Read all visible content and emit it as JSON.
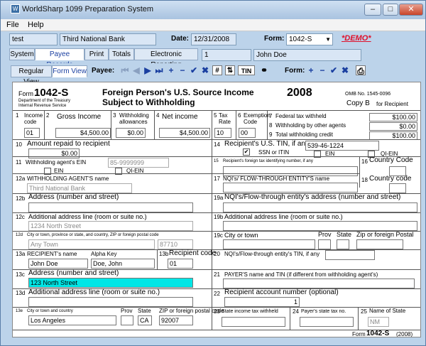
{
  "window": {
    "title": "WorldSharp 1099 Preparation System",
    "min": "–",
    "max": "□",
    "close": "✕"
  },
  "menu": {
    "file": "File",
    "help": "Help"
  },
  "header": {
    "company_id": "test",
    "company_name": "Third National Bank",
    "date_label": "Date:",
    "date": "12/31/2008",
    "form_label": "Form:",
    "form_value": "1042-S",
    "demo": "*DEMO*"
  },
  "tabs": [
    "System",
    "Payee Records",
    "Print",
    "Totals",
    "Electronic Reporting"
  ],
  "record": {
    "num": "1",
    "name": "John Doe"
  },
  "view_tabs": [
    "Regular View",
    "Form View"
  ],
  "toolbar": {
    "payee_label": "Payee:",
    "form_label": "Form:",
    "tin_label": "TIN",
    "hash": "#"
  },
  "form": {
    "form_word": "Form",
    "form_number": "1042-S",
    "dept": "Department of the Treasury",
    "irs": "Internal Revenue Service",
    "title1": "Foreign Person's U.S. Source Income",
    "title2": "Subject to Withholding",
    "year": "2008",
    "omb": "OMB No. 1545-0096",
    "copy": "Copy B",
    "copy_for": "for Recipient",
    "b1": "1",
    "b1l": "Income code",
    "b1v": "01",
    "b2": "2",
    "b2l": "Gross Income",
    "b2v": "$4,500.00",
    "b3": "3",
    "b3l": "Withholding allowances",
    "b3v": "$0.00",
    "b4": "4",
    "b4l": "Net income",
    "b4v": "$4,500.00",
    "b5": "5",
    "b5l": "Tax Rate",
    "b5v": "10",
    "b6": "6",
    "b6l": "Exemption Code",
    "b6v": "00",
    "b7": "7",
    "b7l": "Federal tax withheld",
    "b7v": "$100.00",
    "b8": "8",
    "b8l": "Withholding by other agents",
    "b8v": "$0.00",
    "b9": "9",
    "b9l": "Total withholding credit",
    "b9v": "$100.00",
    "b10": "10",
    "b10l": "Amount repaid to recipient",
    "b10v": "$0.00",
    "b14": "14",
    "b14l": "Recipient's U.S. TIN, if any",
    "b14v": "539-46-1224",
    "ssn": "SSN or ITIN",
    "ein": "EIN",
    "qiein": "QI-EIN",
    "b11": "11",
    "b11l": "Withholding agent's EIN",
    "b11v": "85-9999999",
    "ein2": "EIN",
    "qiein2": "QI-EIN",
    "b15": "15",
    "b15l": "Recipient's foreign tax identifying number, if any",
    "b16": "16",
    "b16l": "Country Code",
    "b12a": "12a",
    "b12al": "WITHHOLDING AGENT'S name",
    "b12av": "Third National Bank",
    "b17": "17",
    "b17l": "NQI's/ FLOW-THROUGH ENTITY'S name",
    "b18": "18",
    "b18l": "Country code",
    "b12b": "12b",
    "b12bl": "Address (number and street)",
    "b19a": "19a",
    "b19al": "NQI's/Flow-through entity's address (number and street)",
    "b12c": "12c",
    "b12cl": "Additional address line (room or suite no.)",
    "b12cv": "1234 North Street",
    "b19b": "19b",
    "b19bl": "Additional address line (room or suite no.)",
    "b12d": "12d",
    "b12dl": "City or town, province or state, and country, ZIP or foreign postal code",
    "b12d_city": "Any Town",
    "b12d_zip": "87710",
    "b19c": "19c",
    "b19cl": "City or town",
    "prov": "Prov",
    "state": "State",
    "zip": "Zip or foreign Postal",
    "b13a": "13a",
    "b13al": "RECIPIENT's name",
    "alpha": "Alpha Key",
    "b13av": "John Doe",
    "alphav": "Doe, John",
    "b13b": "13b",
    "b13bl": "Recipient code",
    "b13bv": "01",
    "b20": "20",
    "b20l": "NQI's/Flow-through entity's TIN, if any",
    "b13c": "13c",
    "b13cl": "Address (number and street)",
    "b13cv": "123 North Street",
    "b21": "21",
    "b21l": "PAYER'S name and TIN (if different from withholding agent's)",
    "b13d": "13d",
    "b13dl": "Additional address line (room or suite no.)",
    "b22": "22",
    "b22l": "Recipient account number (optional)",
    "b22v": "1",
    "b13e": "13e",
    "b13el": "City or town and country",
    "prov2": "Prov",
    "state2": "State",
    "zip2": "ZIP or foreign postal code",
    "b13e_city": "Los Angeles",
    "b13e_state": "CA",
    "b13e_zip": "92007",
    "b23": "23",
    "b23l": "State income tax withheld",
    "b24": "24",
    "b24l": "Payer's state tax no.",
    "b25": "25",
    "b25l": "Name of State",
    "b25v": "NM",
    "footer": "Form",
    "footer_num": "1042-S",
    "footer_year": "(2008)"
  }
}
